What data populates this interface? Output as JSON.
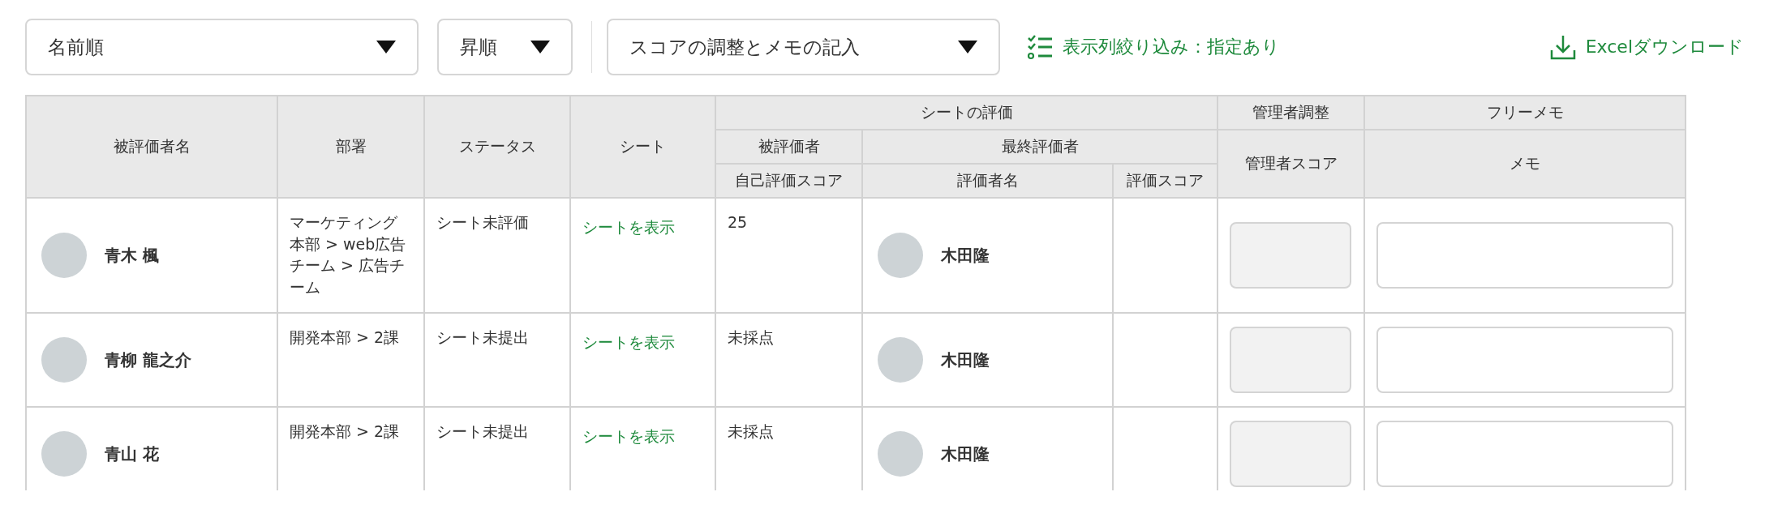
{
  "toolbar": {
    "sort_field": {
      "value": "名前順"
    },
    "sort_order": {
      "value": "昇順"
    },
    "view_mode": {
      "value": "スコアの調整とメモの記入"
    },
    "column_filter": "表示列絞り込み：指定あり",
    "excel_download": "Excelダウンロード"
  },
  "table": {
    "header": {
      "employee": "被評価者名",
      "department": "部署",
      "status": "ステータス",
      "sheet": "シート",
      "sheet_evaluation": "シートの評価",
      "self": "被評価者",
      "self_score": "自己評価スコア",
      "final": "最終評価者",
      "evaluator_name": "評価者名",
      "evaluator_score": "評価スコア",
      "admin_adjust": "管理者調整",
      "admin_score": "管理者スコア",
      "free_memo": "フリーメモ",
      "memo": "メモ"
    },
    "rows": [
      {
        "name": "青木 楓",
        "department": "マーケティング本部 > web広告チーム > 広告チーム",
        "status": "シート未評価",
        "sheet_link": "シートを表示",
        "self_score": "25",
        "evaluator_name": "木田隆",
        "admin_score_disabled": true
      },
      {
        "name": "青柳 龍之介",
        "department": "開発本部 > 2課",
        "status": "シート未提出",
        "sheet_link": "シートを表示",
        "self_score": "未採点",
        "evaluator_name": "木田隆",
        "admin_score_disabled": true
      },
      {
        "name": "青山 花",
        "department": "開発本部 > 2課",
        "status": "シート未提出",
        "sheet_link": "シートを表示",
        "self_score": "未採点",
        "evaluator_name": "木田隆",
        "admin_score_disabled": true
      }
    ]
  }
}
